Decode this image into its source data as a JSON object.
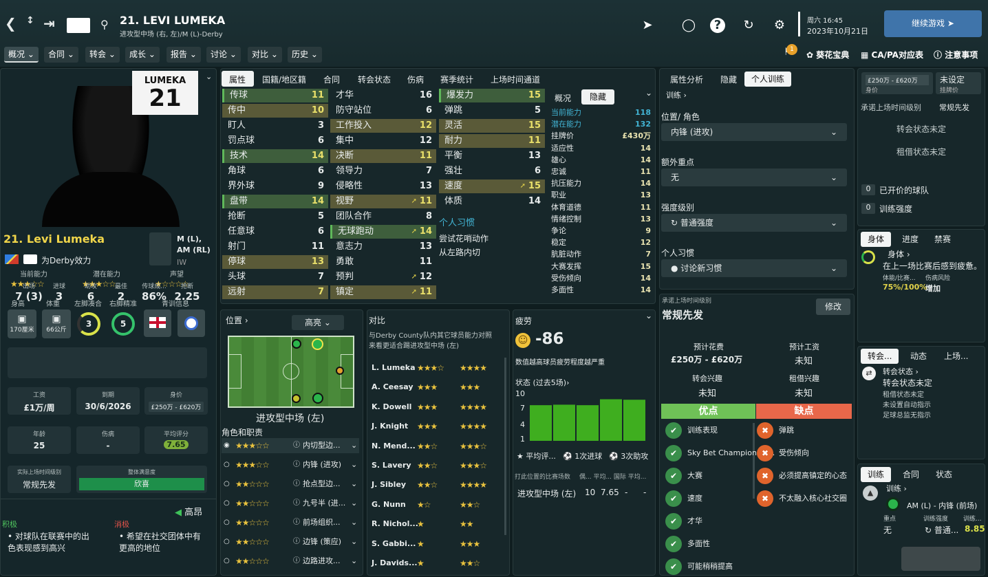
{
  "header": {
    "title": "21. LEVI LUMEKA",
    "subtitle": "进攻型中场 (右, 左)/M (L)-Derby",
    "day_time": "周六 16:45",
    "date": "2023年10月21日",
    "continue": "继续游戏",
    "notif_count": "1"
  },
  "menus": [
    {
      "label": "概况"
    },
    {
      "label": "合同"
    },
    {
      "label": "转会"
    },
    {
      "label": "成长"
    },
    {
      "label": "报告"
    },
    {
      "label": "讨论"
    },
    {
      "label": "对比"
    },
    {
      "label": "历史"
    }
  ],
  "right_links": {
    "guide": "葵花宝典",
    "capa": "CA/PA对应表",
    "notes": "注意事项"
  },
  "player": {
    "shirt_name": "LUMEKA",
    "shirt_no": "21",
    "name": "21. Levi Lumeka",
    "positions": "M (L),\nAM (RL)",
    "pos_short": "IW",
    "club": "为Derby效力",
    "ca_label": "当前能力",
    "pa_label": "潜在能力",
    "rep_label": "声望",
    "ca_stars": "★★★☆☆",
    "pa_stars": "★★★☆☆",
    "rep_stars": "★☆☆☆☆",
    "h_label": "身高",
    "w_label": "体重",
    "lf_label": "左脚凑合",
    "rf_label": "右脚精准",
    "youth_label": "青训信息",
    "height": "170厘米",
    "weight": "66公斤",
    "left_foot": "3",
    "right_foot": "5",
    "stats": [
      {
        "l": "出场",
        "v": "7 (3)"
      },
      {
        "l": "进球",
        "v": "3"
      },
      {
        "l": "助攻",
        "v": "6"
      },
      {
        "l": "最佳",
        "v": "2"
      },
      {
        "l": "传球成...",
        "v": "86%"
      },
      {
        "l": "抢断",
        "v": "2.25"
      }
    ],
    "wage_l": "工资",
    "wage": "£1万/周",
    "expiry_l": "到期",
    "expiry": "30/6/2026",
    "value_l": "身价",
    "value": "£250万 - £620万",
    "age_l": "年龄",
    "age": "25",
    "inj_l": "伤病",
    "inj": "-",
    "rating_l": "平均评分",
    "rating": "7.65",
    "playtime_l": "实际上场时间级别",
    "playtime": "常规先发",
    "satis_l": "整体满意度",
    "satis": "欣喜",
    "mood": "高昂",
    "pos_l": "积极",
    "neg_l": "消极",
    "pos_txt": "对球队在联赛中的出色表现感到高兴",
    "neg_txt": "希望在社交团体中有更高的地位"
  },
  "attr_tabs": [
    "属性",
    "国籍/地区籍",
    "合同",
    "转会状态",
    "伤病",
    "赛季统计",
    "上场时间通道"
  ],
  "tech": [
    [
      "传球",
      "11",
      "hi"
    ],
    [
      "传中",
      "10",
      "mid"
    ],
    [
      "盯人",
      "3",
      ""
    ],
    [
      "罚点球",
      "6",
      ""
    ],
    [
      "技术",
      "14",
      "hi"
    ],
    [
      "角球",
      "6",
      ""
    ],
    [
      "界外球",
      "9",
      ""
    ],
    [
      "盘带",
      "14",
      "hi"
    ],
    [
      "抢断",
      "5",
      ""
    ],
    [
      "任意球",
      "6",
      ""
    ],
    [
      "射门",
      "11",
      ""
    ],
    [
      "停球",
      "13",
      "mid"
    ],
    [
      "头球",
      "7",
      ""
    ],
    [
      "远射",
      "7",
      "mid"
    ]
  ],
  "ment": [
    [
      "才华",
      "16",
      ""
    ],
    [
      "防守站位",
      "6",
      ""
    ],
    [
      "工作投入",
      "12",
      "mid"
    ],
    [
      "集中",
      "12",
      ""
    ],
    [
      "决断",
      "11",
      "mid"
    ],
    [
      "领导力",
      "7",
      "",
      ""
    ],
    [
      "侵略性",
      "13",
      ""
    ],
    [
      "视野",
      "11",
      "mid",
      "a"
    ],
    [
      "团队合作",
      "8",
      ""
    ],
    [
      "无球跑动",
      "14",
      "hi",
      "a"
    ],
    [
      "意志力",
      "13",
      ""
    ],
    [
      "勇敢",
      "11",
      ""
    ],
    [
      "预判",
      "12",
      "",
      "a"
    ],
    [
      "镇定",
      "11",
      "mid",
      "a"
    ]
  ],
  "phys": [
    [
      "爆发力",
      "15",
      "hi"
    ],
    [
      "弹跳",
      "5",
      ""
    ],
    [
      "灵活",
      "15",
      "mid"
    ],
    [
      "耐力",
      "11",
      "mid"
    ],
    [
      "平衡",
      "13",
      ""
    ],
    [
      "强壮",
      "6",
      ""
    ],
    [
      "速度",
      "15",
      "mid",
      "a"
    ],
    [
      "体质",
      "14",
      ""
    ]
  ],
  "habits_title": "个人习惯",
  "habits": [
    "尝试花哨动作",
    "从左路内切"
  ],
  "hidden_tabs": [
    "概况",
    "隐藏"
  ],
  "hidden": [
    [
      "当前能力",
      "118"
    ],
    [
      "潜在能力",
      "132"
    ],
    [
      "挂牌价",
      "£430万"
    ],
    [
      "适应性",
      "14"
    ],
    [
      "雄心",
      "14"
    ],
    [
      "忠诚",
      "11"
    ],
    [
      "抗压能力",
      "14"
    ],
    [
      "职业",
      "13"
    ],
    [
      "体育道德",
      "11"
    ],
    [
      "情绪控制",
      "13"
    ],
    [
      "争论",
      "9"
    ],
    [
      "稳定",
      "12"
    ],
    [
      "肮脏动作",
      "7"
    ],
    [
      "大赛发挥",
      "15"
    ],
    [
      "受伤倾向",
      "14"
    ],
    [
      "多面性",
      "14"
    ]
  ],
  "pos_panel": {
    "title": "位置",
    "highlight": "高亮",
    "role": "进攻型中场 (左)",
    "roles_title": "角色和职责",
    "roles": [
      [
        "★★★☆☆",
        "内切型边..."
      ],
      [
        "★★★☆☆",
        "内锋 (进攻)"
      ],
      [
        "★★☆☆☆",
        "抢点型边..."
      ],
      [
        "★★☆☆☆",
        "九号半 (进..."
      ],
      [
        "★★☆☆☆",
        "前场组织..."
      ],
      [
        "★★☆☆☆",
        "边锋 (策应)"
      ],
      [
        "★★☆☆☆",
        "边路进攻..."
      ]
    ]
  },
  "compare": {
    "title": "对比",
    "desc": "与Derby County队内其它球员能力对照来看更适合踢进攻型中场 (左)",
    "rows": [
      [
        "L. Lumeka",
        "★★★☆",
        "★★★★"
      ],
      [
        "A. Ceesay",
        "★★★",
        "★★★"
      ],
      [
        "K. Dowell",
        "★★★",
        "★★★★"
      ],
      [
        "J. Knight",
        "★★★",
        "★★★★"
      ],
      [
        "N. Mend...",
        "★★☆",
        "★★★☆"
      ],
      [
        "S. Lavery",
        "★★☆",
        "★★★☆"
      ],
      [
        "J. Sibley",
        "★★☆",
        "★★★★"
      ],
      [
        "G. Nunn",
        "★☆",
        "★★☆"
      ],
      [
        "R. Nichol...",
        "★",
        "★★"
      ],
      [
        "S. Gabbi...",
        "★",
        "★★★"
      ],
      [
        "J. Davids...",
        "★",
        "★★☆"
      ]
    ]
  },
  "fatigue": {
    "title": "疲劳",
    "value": "-86",
    "desc": "数值越高球员疲劳程度越严重",
    "form_title": "状态 (过去5场)",
    "avg": "平均评...",
    "goals": "1次进球",
    "assists": "3次助攻",
    "table_h": "打此位置的比赛场数",
    "row_pos": "进攻型中场 (左)",
    "row_apps": "10",
    "row_rating": "7.65",
    "row_a": "-",
    "row_b": "-"
  },
  "form": {
    "values": [
      7.2,
      7.3,
      7.2,
      8.4,
      8.3
    ],
    "ylim": [
      0,
      10
    ],
    "ticks": [
      "10",
      "7",
      "4",
      "1"
    ]
  },
  "training": {
    "tabs": [
      "属性分析",
      "隐藏",
      "个人训练"
    ],
    "train_l": "训练",
    "pos_l": "位置/ 角色",
    "pos": "内锋 (进攻)",
    "extra_l": "额外重点",
    "extra": "无",
    "int_l": "强度级别",
    "int": "普通强度",
    "habit_l": "个人习惯",
    "habit": "讨论新习惯"
  },
  "playing": {
    "title": "承诺上场时间级别",
    "value": "常规先发",
    "edit": "修改",
    "fee_l": "预计花费",
    "fee": "£250万 - £620万",
    "wage_l": "预计工资",
    "wage": "未知",
    "tint_l": "转会兴趣",
    "tint": "未知",
    "lint_l": "租借兴趣",
    "lint": "未知",
    "pro": "优点",
    "con": "缺点",
    "pros": [
      "训练表现",
      "Sky Bet Championshi...",
      "大赛",
      "速度",
      "才华",
      "多面性",
      "可能稍稍提高"
    ],
    "cons": [
      "弹跳",
      "受伤倾向",
      "必须提高镇定的心态",
      "不太融入核心社交圈"
    ]
  },
  "side": {
    "value": "£250万 - £620万",
    "value_l": "身价",
    "asking": "未设定",
    "asking_l": "挂牌价",
    "promise_l": "承诺上场时间级别",
    "promise": "常规先发",
    "transfer": "转会状态未定",
    "loan": "租借状态未定",
    "bid_n": "0",
    "bid_l": "已开价的球队",
    "int_n": "0",
    "int_l": "训练强度",
    "tabs1": [
      "身体",
      "进度",
      "禁赛"
    ],
    "body": "身体",
    "body_txt": "在上一场比赛后感到疲惫。",
    "cond_l": "体能/比赛...",
    "risk_l": "伤病风险",
    "cond": "75%/100%",
    "risk": "增加",
    "tabs2": [
      "转会...",
      "动态",
      "上场..."
    ],
    "tr_l": "转会状态",
    "tr_v": "转会状态未定",
    "tr_lines": [
      "租借状态未定",
      "未设置自动指示",
      "足球总监无指示"
    ],
    "tabs3": [
      "训练",
      "合同",
      "状态"
    ],
    "tn_l": "训练",
    "tn_pos": "AM (L) - 内锋 (前场)",
    "focus_l": "重点",
    "focus": "无",
    "int": "普通...",
    "tr2_l": "训练...",
    "tr2": "8.85"
  }
}
